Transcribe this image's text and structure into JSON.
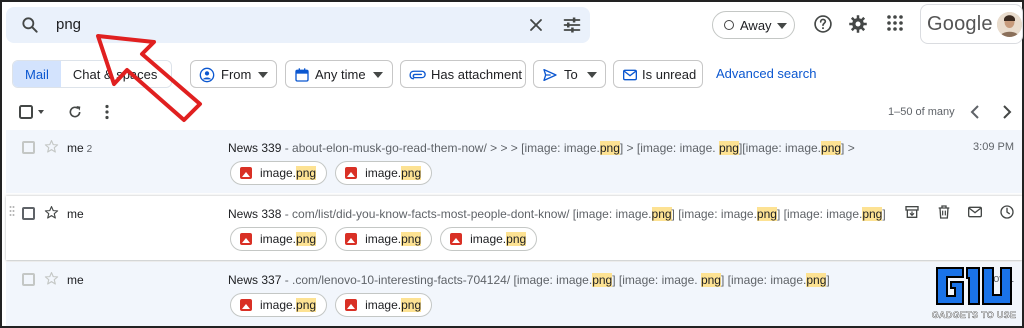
{
  "search": {
    "value": "png"
  },
  "status": {
    "label": "Away"
  },
  "brand": {
    "name": "Google"
  },
  "filters": {
    "mail_label": "Mail",
    "chat_label": "Chat & spaces",
    "from_label": "From",
    "time_label": "Any time",
    "attachment_label": "Has attachment",
    "to_label": "To",
    "unread_label": "Is unread",
    "advanced_label": "Advanced search"
  },
  "pagination": {
    "range": "1–50 of many"
  },
  "highlight_term": "png",
  "emails": [
    {
      "sender": "me",
      "thread_count": "2",
      "subject": "News 339",
      "snippet_parts": [
        " - about-elon-musk-go-read-them-now/ > > > [image: image.",
        "png",
        "] > [image: image. ",
        "png",
        "][image: image.",
        "png",
        "] >"
      ],
      "time": "3:09 PM",
      "attachments": [
        "image.png",
        "image.png"
      ]
    },
    {
      "sender": "me",
      "thread_count": "",
      "subject": "News 338",
      "snippet_parts": [
        " - com/list/did-you-know-facts-most-people-dont-know/ [image: image.",
        "png",
        "] [image: image.",
        "png",
        "] [image: image.",
        "png",
        "]"
      ],
      "time": "",
      "attachments": [
        "image.png",
        "image.png",
        "image.png"
      ]
    },
    {
      "sender": "me",
      "thread_count": "",
      "subject": "News 337",
      "snippet_parts": [
        " - .com/lenovo-10-interesting-facts-704124/ [image: image.",
        "png",
        "] [image: image. ",
        "png",
        "] [image: image.",
        "png",
        "]"
      ],
      "time": "Nov 1",
      "attachments": [
        "image.png",
        "image.png"
      ]
    }
  ],
  "watermark": {
    "text": "GADGETS TO USE"
  },
  "colors": {
    "accent": "#0b57d0",
    "highlight": "#fde293",
    "arrow": "#e02020",
    "row_read": "#f2f6fc"
  }
}
